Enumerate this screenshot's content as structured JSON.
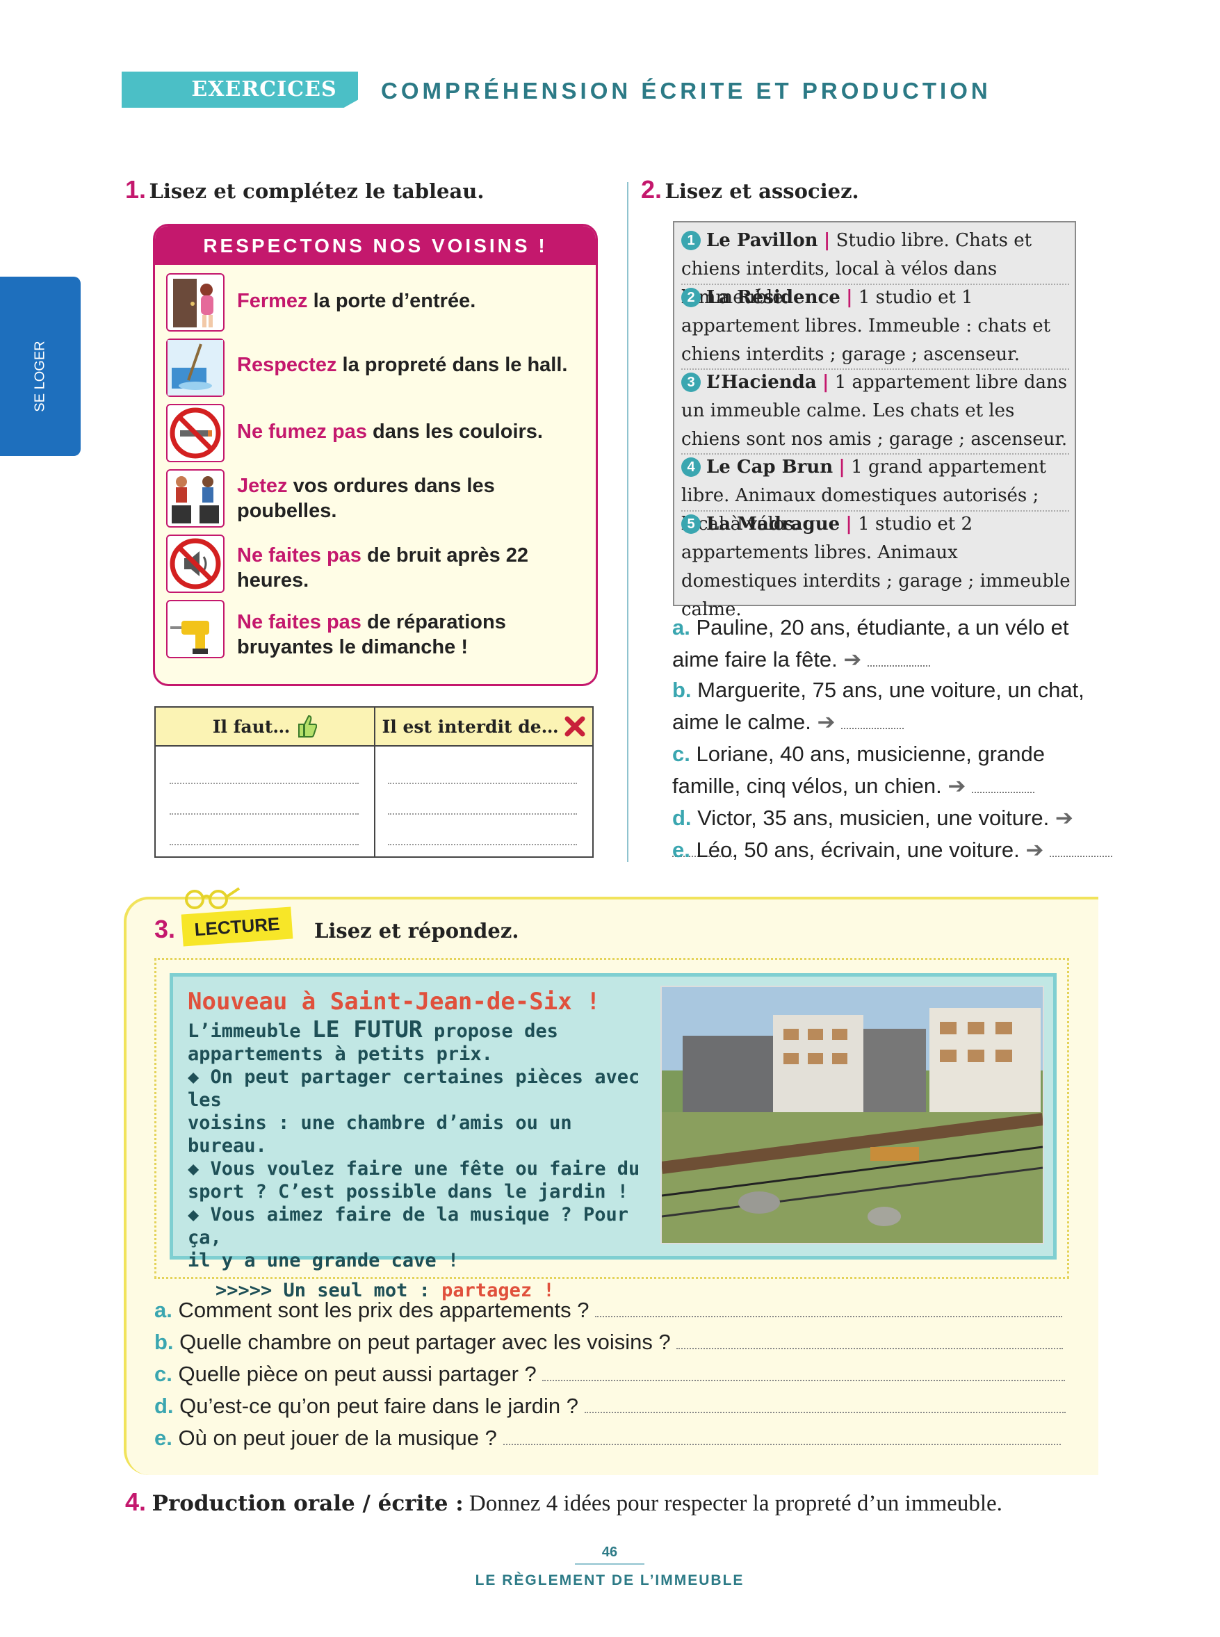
{
  "header": {
    "tag": "EXERCICES",
    "title": "COMPRÉHENSION ÉCRITE ET PRODUCTION"
  },
  "side_tab": "SE LOGER",
  "ex1": {
    "num": "1.",
    "title": "Lisez et complétez le tableau.",
    "box_title": "RESPECTONS NOS VOISINS !",
    "rules": [
      {
        "hl": "Fermez",
        "rest": " la porte d’entrée.",
        "icon": "door-icon"
      },
      {
        "hl": "Respectez",
        "rest": " la propreté dans le hall.",
        "icon": "cleaning-icon"
      },
      {
        "hl": "Ne fumez pas",
        "rest": " dans les couloirs.",
        "icon": "no-smoking-icon"
      },
      {
        "hl": "Jetez",
        "rest": " vos ordures dans les poubelles.",
        "icon": "trash-bins-icon"
      },
      {
        "hl": "Ne faites pas",
        "rest": " de bruit après 22 heures.",
        "icon": "no-noise-icon"
      },
      {
        "hl": "Ne faites pas",
        "rest": " de réparations bruyantes le dimanche !",
        "icon": "drill-icon"
      }
    ],
    "table": {
      "col1": "Il faut…",
      "col2": "Il est interdit de…"
    }
  },
  "ex2": {
    "num": "2.",
    "title": "Lisez et associez.",
    "ads": [
      {
        "n": "1",
        "name": "Le Pavillon",
        "text": "Studio libre. Chats et chiens interdits, local à vélos dans l’immeuble."
      },
      {
        "n": "2",
        "name": "La Résidence",
        "text": "1 studio et 1 appartement libres. Immeuble : chats et chiens interdits ; garage ; ascenseur."
      },
      {
        "n": "3",
        "name": "L’Hacienda",
        "text": "1 appartement libre dans un immeuble calme. Les chats et les chiens sont nos amis ; garage ; ascenseur."
      },
      {
        "n": "4",
        "name": "Le Cap Brun",
        "text": "1 grand appartement libre. Animaux domestiques autorisés ; local à vélos."
      },
      {
        "n": "5",
        "name": "La Madrague",
        "text": "1 studio et 2 appartements libres. Animaux domestiques interdits ; garage ; immeuble calme."
      }
    ],
    "people": [
      {
        "l": "a.",
        "t1": " Pauline, 20 ans, étudiante, a un vélo et",
        "t2": "aime faire la fête."
      },
      {
        "l": "b.",
        "t1": " Marguerite, 75 ans, une voiture, un chat,",
        "t2": "aime le calme."
      },
      {
        "l": "c.",
        "t1": " Loriane, 40 ans, musicienne, grande",
        "t2": "famille, cinq vélos, un chien."
      },
      {
        "l": "d.",
        "t1": " Victor, 35 ans, musicien, une voiture.",
        "t2": ""
      },
      {
        "l": "e.",
        "t1": " Léo, 50 ans, écrivain, une voiture.",
        "t2": ""
      }
    ]
  },
  "ex3": {
    "num": "3.",
    "tag": "LECTURE",
    "title": "Lisez et répondez.",
    "card": {
      "title": "Nouveau à Saint-Jean-de-Six !",
      "l1a": "L’immeuble ",
      "l1b": "LE FUTUR",
      "l1c": " propose des",
      "l2": "appartements à petits prix.",
      "l3": "◆ On peut partager certaines pièces avec les",
      "l4": "voisins : une chambre d’amis ou un bureau.",
      "l5": "◆ Vous voulez faire une fête ou faire du",
      "l6": "sport ? C’est possible dans le jardin !",
      "l7": "◆ Vous aimez faire de la musique ? Pour ça,",
      "l8": "il y a une grande cave !",
      "l9a": ">>>>> Un seul mot : ",
      "l9b": "partagez !"
    },
    "questions": [
      {
        "l": "a.",
        "t": " Comment sont les prix des appartements ?"
      },
      {
        "l": "b.",
        "t": " Quelle chambre on peut partager avec les voisins ?"
      },
      {
        "l": "c.",
        "t": " Quelle pièce on peut aussi partager ?"
      },
      {
        "l": "d.",
        "t": " Qu’est-ce qu’on peut faire dans le jardin ?"
      },
      {
        "l": "e.",
        "t": " Où on peut jouer de la musique ?"
      }
    ]
  },
  "ex4": {
    "num": "4.",
    "lead": "Production orale / écrite :",
    "text": " Donnez 4 idées pour respecter la propreté d’un immeuble."
  },
  "footer": {
    "page": "46",
    "title": "LE RÈGLEMENT DE L’IMMEUBLE"
  },
  "colors": {
    "accent": "#c4186d",
    "teal": "#3aa6b0",
    "header_teal": "#4bbfc6",
    "side_blue": "#1e6fbd",
    "lecture_yellow": "#f7e628"
  }
}
